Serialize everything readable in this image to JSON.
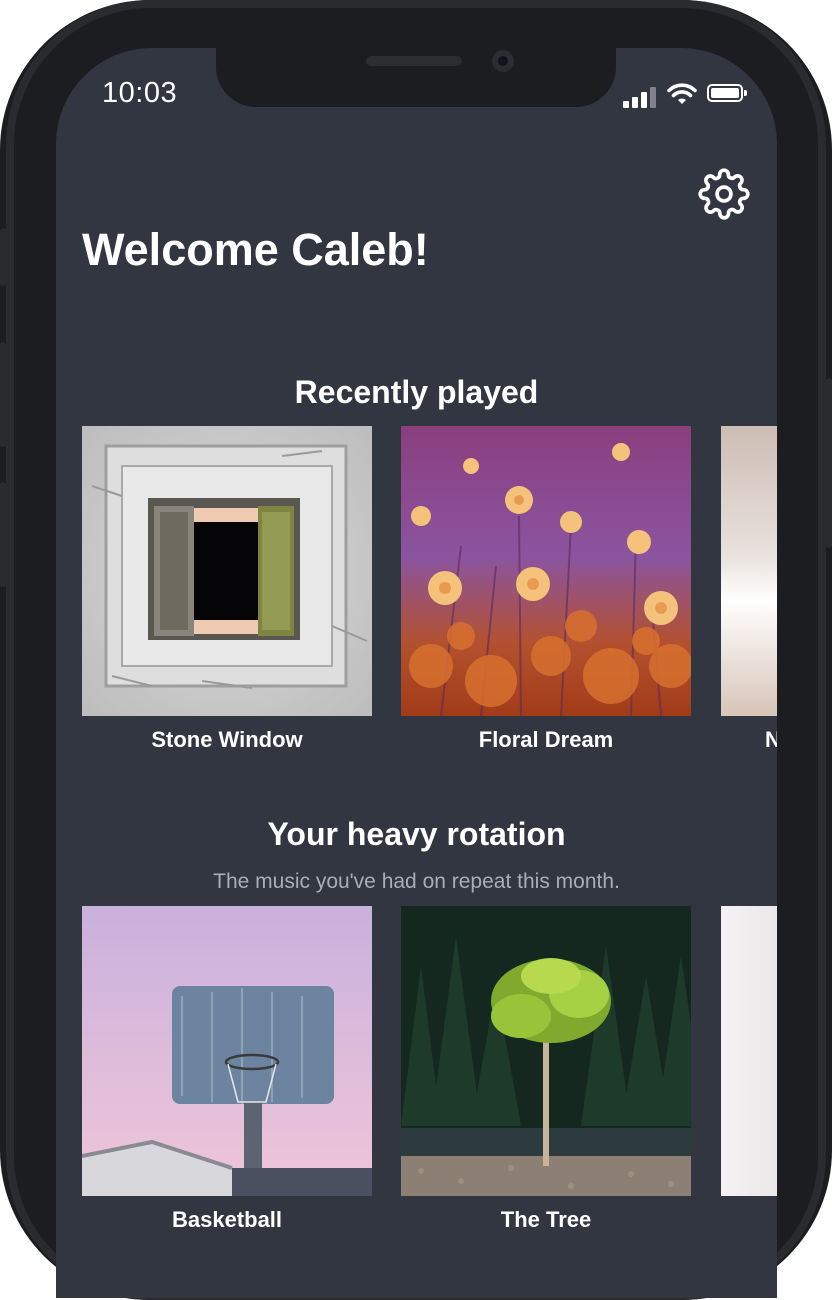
{
  "status_bar": {
    "time": "10:03"
  },
  "header": {
    "settings_icon": "gear-icon",
    "welcome": "Welcome Caleb!"
  },
  "recently_played": {
    "title": "Recently played",
    "items": [
      {
        "label": "Stone Window"
      },
      {
        "label": "Floral Dream"
      },
      {
        "label": "N"
      }
    ]
  },
  "heavy_rotation": {
    "title": "Your heavy rotation",
    "subtitle": "The music you've had on repeat this month.",
    "items": [
      {
        "label": "Basketball"
      },
      {
        "label": "The Tree"
      }
    ]
  },
  "colors": {
    "screen_bg": "#323641",
    "text": "#ffffff",
    "subtext": "#a9adb6"
  }
}
